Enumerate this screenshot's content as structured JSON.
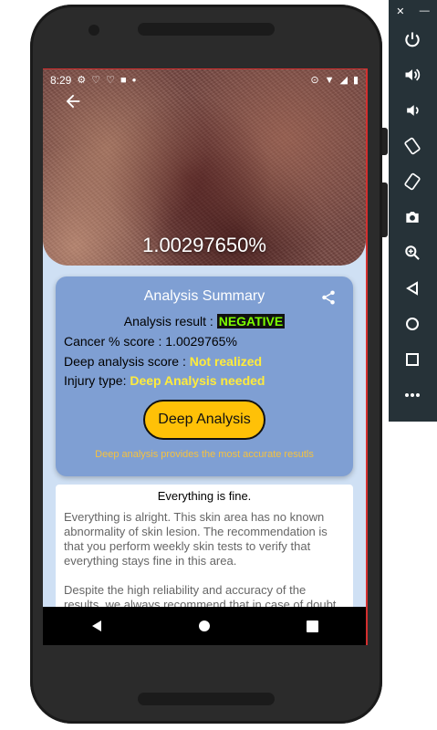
{
  "status_bar": {
    "time": "8:29",
    "left_icons": [
      "gear-icon",
      "heart-outline-icon",
      "heart-outline-icon",
      "square-icon",
      "dot-icon"
    ],
    "right_icons": [
      "location-icon",
      "wifi-icon",
      "signal-icon",
      "battery-icon"
    ]
  },
  "hero": {
    "percentage": "1.00297650%"
  },
  "summary": {
    "title": "Analysis Summary",
    "result_label": "Analysis result :",
    "result_value": "NEGATIVE",
    "cancer_score": "Cancer % score : 1.0029765%",
    "deep_score_label": "Deep analysis score :",
    "deep_score_value": "Not realized",
    "injury_label": "Injury type:",
    "injury_value": "Deep Analysis needed",
    "button_label": "Deep Analysis",
    "hint": "Deep analysis provides the most accurate resutls"
  },
  "info": {
    "title": "Everything is fine.",
    "paragraph1": "Everything is alright. This skin area has no known abnormality of skin lesion. The recommendation is that you perform weekly skin tests to verify that everything stays fine in this area.",
    "paragraph2": "Despite the high reliability and accuracy of the results, we always recommend that in case of doubt go to a"
  },
  "emulator_panel": {
    "close": "✕",
    "minimize": "—",
    "buttons": [
      "power-icon",
      "volume-up-icon",
      "volume-down-icon",
      "rotate-left-icon",
      "rotate-right-icon",
      "camera-icon",
      "zoom-icon",
      "back-icon",
      "home-icon",
      "overview-icon",
      "more-icon"
    ]
  },
  "colors": {
    "card_bg": "#7f9fd3",
    "accent_yellow": "#ffeb3b",
    "button_bg": "#ffc107",
    "negative_text": "#7CFC00"
  }
}
